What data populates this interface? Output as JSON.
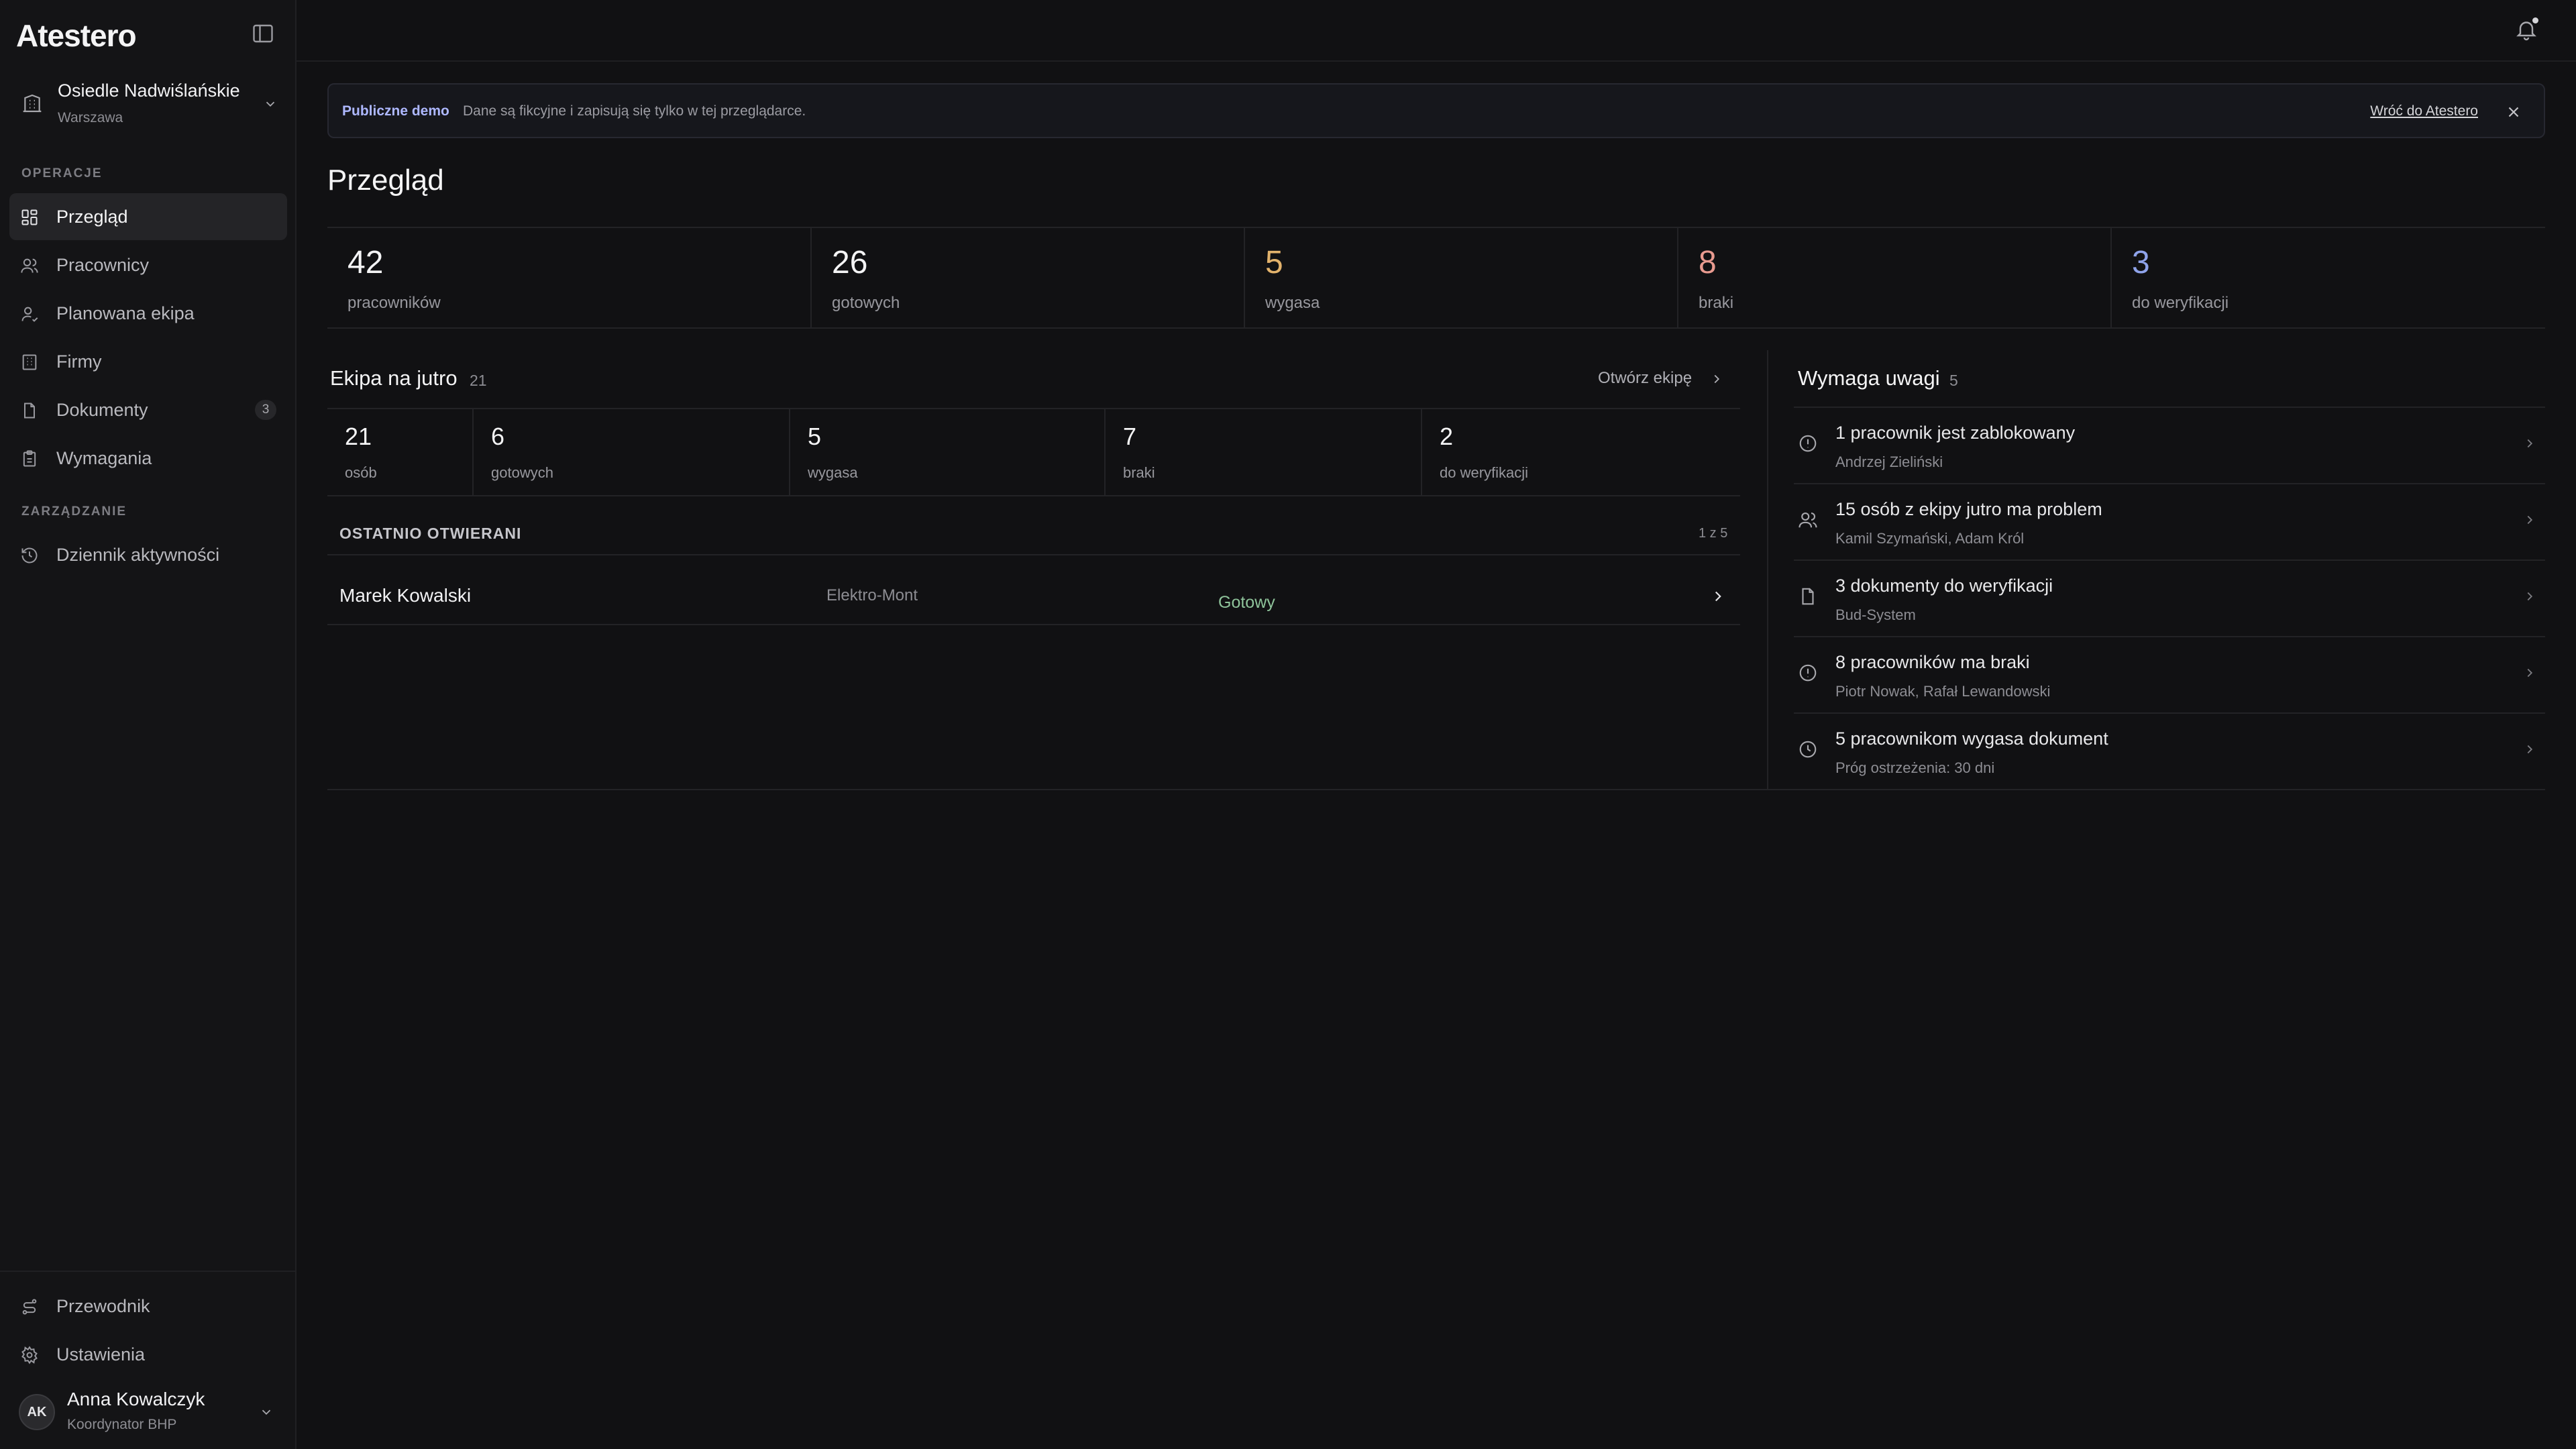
{
  "app": {
    "logo": "Atestero"
  },
  "site": {
    "name": "Osiedle Nadwiślańskie",
    "city": "Warszawa"
  },
  "sidebar": {
    "section_ops": "OPERACJE",
    "section_mgmt": "ZARZĄDZANIE",
    "items": [
      {
        "label": "Przegląd",
        "icon": "dashboard-icon"
      },
      {
        "label": "Pracownicy",
        "icon": "users-icon"
      },
      {
        "label": "Planowana ekipa",
        "icon": "crew-icon"
      },
      {
        "label": "Firmy",
        "icon": "building-icon"
      },
      {
        "label": "Dokumenty",
        "icon": "document-icon",
        "count": "3"
      },
      {
        "label": "Wymagania",
        "icon": "clipboard-icon"
      }
    ],
    "mgmt_items": [
      {
        "label": "Dziennik aktywności",
        "icon": "history-icon"
      }
    ],
    "footer": [
      {
        "label": "Przewodnik",
        "icon": "route-icon"
      },
      {
        "label": "Ustawienia",
        "icon": "gear-icon"
      }
    ]
  },
  "user": {
    "initials": "AK",
    "name": "Anna Kowalczyk",
    "role": "Koordynator BHP"
  },
  "banner": {
    "tag": "Publiczne demo",
    "message": "Dane są fikcyjne i zapisują się tylko w tej przeglądarce.",
    "link": "Wróć do Atestero"
  },
  "page": {
    "title": "Przegląd"
  },
  "stats": [
    {
      "value": "42",
      "label": "pracowników",
      "color": "#f4f4f5"
    },
    {
      "value": "26",
      "label": "gotowych",
      "color": "#f4f4f5"
    },
    {
      "value": "5",
      "label": "wygasa",
      "color": "#e3b36c"
    },
    {
      "value": "8",
      "label": "braki",
      "color": "#e89a8f"
    },
    {
      "value": "3",
      "label": "do weryfikacji",
      "color": "#8fa3ea"
    }
  ],
  "crew": {
    "title": "Ekipa na jutro",
    "count": "21",
    "open_label": "Otwórz ekipę",
    "stats": [
      {
        "value": "21",
        "label": "osób"
      },
      {
        "value": "6",
        "label": "gotowych"
      },
      {
        "value": "5",
        "label": "wygasa"
      },
      {
        "value": "7",
        "label": "braki"
      },
      {
        "value": "2",
        "label": "do weryfikacji"
      }
    ]
  },
  "recent": {
    "heading": "OSTATNIO OTWIERANI",
    "pager": "1 z 5",
    "rows": [
      {
        "name": "Marek Kowalski",
        "company": "Elektro-Mont",
        "status": "Gotowy"
      }
    ]
  },
  "attention": {
    "title": "Wymaga uwagi",
    "count": "5",
    "items": [
      {
        "title": "1 pracownik jest zablokowany",
        "sub": "Andrzej Zieliński",
        "icon": "alert-circle-icon"
      },
      {
        "title": "15 osób z ekipy jutro ma problem",
        "sub": "Kamil Szymański, Adam Król",
        "icon": "users-icon"
      },
      {
        "title": "3 dokumenty do weryfikacji",
        "sub": "Bud-System",
        "icon": "document-icon"
      },
      {
        "title": "8 pracowników ma braki",
        "sub": "Piotr Nowak, Rafał Lewandowski",
        "icon": "alert-circle-icon"
      },
      {
        "title": "5 pracownikom wygasa dokument",
        "sub": "Próg ostrzeżenia: 30 dni",
        "icon": "clock-icon"
      }
    ]
  }
}
